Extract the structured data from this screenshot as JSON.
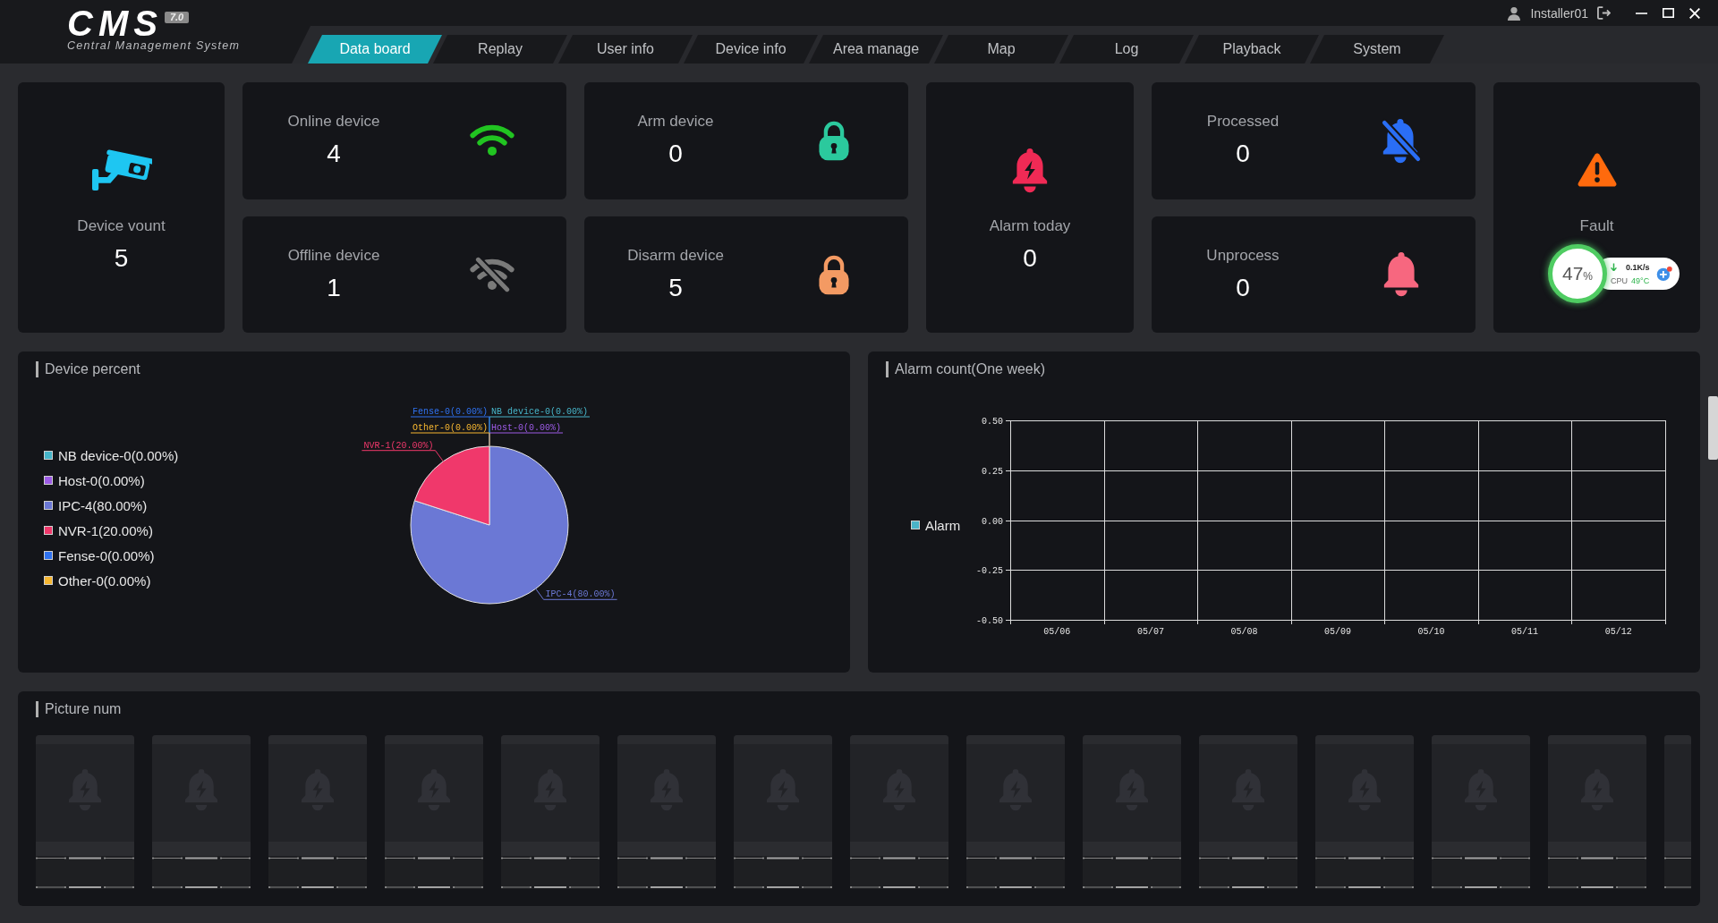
{
  "app": {
    "logo": "CMS",
    "version": "7.0",
    "subtitle": "Central Management System"
  },
  "user": {
    "name": "Installer01"
  },
  "tabs": [
    {
      "label": "Data board",
      "selected": true
    },
    {
      "label": "Replay",
      "selected": false
    },
    {
      "label": "User info",
      "selected": false
    },
    {
      "label": "Device info",
      "selected": false
    },
    {
      "label": "Area manage",
      "selected": false
    },
    {
      "label": "Map",
      "selected": false
    },
    {
      "label": "Log",
      "selected": false
    },
    {
      "label": "Playback",
      "selected": false
    },
    {
      "label": "System",
      "selected": false
    }
  ],
  "stat_columns": [
    {
      "cards": [
        {
          "label": "Device vount",
          "value": "5"
        }
      ]
    },
    {
      "cards": [
        {
          "label": "Online device",
          "value": "4"
        },
        {
          "label": "Offline device",
          "value": "1"
        }
      ]
    },
    {
      "cards": [
        {
          "label": "Arm device",
          "value": "0"
        },
        {
          "label": "Disarm device",
          "value": "5"
        }
      ]
    },
    {
      "cards": [
        {
          "label": "Alarm today",
          "value": "0"
        }
      ]
    },
    {
      "cards": [
        {
          "label": "Processed",
          "value": "0"
        },
        {
          "label": "Unprocess",
          "value": "0"
        }
      ]
    },
    {
      "cards": [
        {
          "label": "Fault"
        }
      ]
    }
  ],
  "floating_monitor": {
    "usage": "47",
    "unit": "%",
    "speed": "0.1K/s",
    "cpu_label": "CPU",
    "temperature": "49°C"
  },
  "device_percent": {
    "title": "Device percent",
    "legend": [
      {
        "label": "NB device-0(0.00%)",
        "color": "#47b5c9"
      },
      {
        "label": "Host-0(0.00%)",
        "color": "#9d5ce6"
      },
      {
        "label": "IPC-4(80.00%)",
        "color": "#6b78d5"
      },
      {
        "label": "NVR-1(20.00%)",
        "color": "#f0386b"
      },
      {
        "label": "Fense-0(0.00%)",
        "color": "#2f72f0"
      },
      {
        "label": "Other-0(0.00%)",
        "color": "#f7b731"
      }
    ],
    "chart_data": {
      "type": "pie",
      "categories": [
        "NB device-0(0.00%)",
        "Host-0(0.00%)",
        "IPC-4(80.00%)",
        "NVR-1(20.00%)",
        "Fense-0(0.00%)",
        "Other-0(0.00%)"
      ],
      "values": [
        0,
        0,
        80,
        20,
        0,
        0
      ]
    }
  },
  "alarm_count": {
    "title": "Alarm count(One week)",
    "chart_data": {
      "type": "bar",
      "categories": [
        "05/06",
        "05/07",
        "05/08",
        "05/09",
        "05/10",
        "05/11",
        "05/12"
      ],
      "ylim": [
        -0.5,
        0.5
      ],
      "yticks": [
        {
          "value": 0.5,
          "label": "0.50"
        },
        {
          "value": 0.25,
          "label": "0.25"
        },
        {
          "value": 0,
          "label": "0.00"
        },
        {
          "value": -0.25,
          "label": "-0.25"
        },
        {
          "value": -0.5,
          "label": "-0.50"
        }
      ],
      "grid": true,
      "series": [
        {
          "name": "Alarm",
          "color": "#4bb3c8",
          "values": [
            0,
            0,
            0,
            0,
            0,
            0,
            0
          ]
        }
      ]
    }
  },
  "picture_num": {
    "title": "Picture num",
    "pictures": [
      {
        "kind": "placeholder"
      },
      {
        "kind": "placeholder"
      },
      {
        "kind": "placeholder"
      },
      {
        "kind": "placeholder"
      },
      {
        "kind": "placeholder"
      },
      {
        "kind": "placeholder"
      },
      {
        "kind": "placeholder"
      },
      {
        "kind": "placeholder"
      },
      {
        "kind": "placeholder"
      },
      {
        "kind": "placeholder"
      },
      {
        "kind": "placeholder"
      },
      {
        "kind": "placeholder"
      },
      {
        "kind": "placeholder"
      },
      {
        "kind": "placeholder"
      },
      {
        "kind": "placeholder"
      }
    ]
  }
}
